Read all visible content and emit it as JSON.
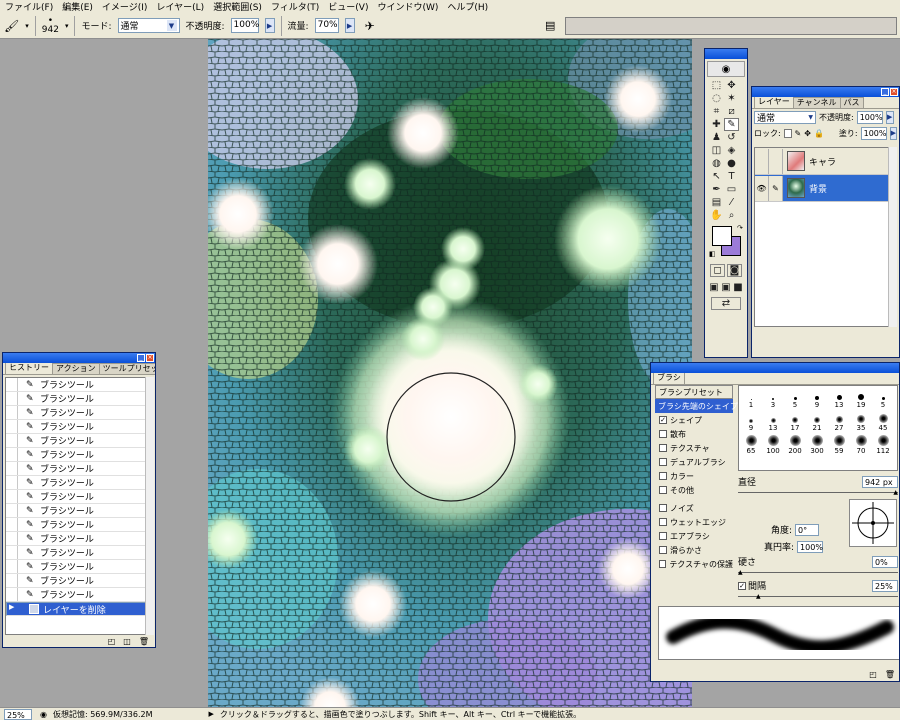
{
  "menubar": {
    "items": [
      "ファイル(F)",
      "編集(E)",
      "イメージ(I)",
      "レイヤー(L)",
      "選択範囲(S)",
      "フィルタ(T)",
      "ビュー(V)",
      "ウインドウ(W)",
      "ヘルプ(H)"
    ]
  },
  "options": {
    "brush_size": "942",
    "mode_label": "モード:",
    "mode_value": "通常",
    "opacity_label": "不透明度:",
    "opacity_value": "100%",
    "flow_label": "流量:",
    "flow_value": "70%"
  },
  "history_panel": {
    "tabs": [
      "ヒストリー",
      "アクション",
      "ツールプリセット"
    ],
    "items": [
      "ブラシツール",
      "ブラシツール",
      "ブラシツール",
      "ブラシツール",
      "ブラシツール",
      "ブラシツール",
      "ブラシツール",
      "ブラシツール",
      "ブラシツール",
      "ブラシツール",
      "ブラシツール",
      "ブラシツール",
      "ブラシツール",
      "ブラシツール",
      "ブラシツール",
      "ブラシツール"
    ],
    "selected": "レイヤーを削除"
  },
  "layers_panel": {
    "tabs": [
      "レイヤー",
      "チャンネル",
      "パス"
    ],
    "blend_mode": "通常",
    "opacity_label": "不透明度:",
    "opacity_value": "100%",
    "lock_label": "ロック:",
    "fill_label": "塗り:",
    "fill_value": "100%",
    "layers": [
      {
        "name": "キャラ",
        "visible": false,
        "active": false
      },
      {
        "name": "背景",
        "visible": true,
        "active": true
      }
    ]
  },
  "brush_panel": {
    "tab": "ブラシ",
    "header": "ブラシプリセット",
    "selected_item": "ブラシ先端のシェイプ",
    "options": [
      {
        "label": "シェイプ",
        "checked": true
      },
      {
        "label": "散布",
        "checked": false
      },
      {
        "label": "テクスチャ",
        "checked": false
      },
      {
        "label": "デュアルブラシ",
        "checked": false
      },
      {
        "label": "カラー",
        "checked": false
      },
      {
        "label": "その他",
        "checked": false
      },
      {
        "label": "ノイズ",
        "checked": false
      },
      {
        "label": "ウェットエッジ",
        "checked": false
      },
      {
        "label": "エアブラシ",
        "checked": false
      },
      {
        "label": "滑らかさ",
        "checked": false
      },
      {
        "label": "テクスチャの保護",
        "checked": false
      }
    ],
    "presets_row1": [
      "1",
      "3",
      "5",
      "9",
      "13",
      "19",
      "5"
    ],
    "presets_row2": [
      "9",
      "13",
      "17",
      "21",
      "27",
      "35",
      "45"
    ],
    "presets_row3": [
      "65",
      "100",
      "200",
      "300",
      "59",
      "70",
      "112"
    ],
    "diameter_label": "直径",
    "diameter_value": "942 px",
    "angle_label": "角度:",
    "angle_value": "0°",
    "roundness_label": "真円率:",
    "roundness_value": "100%",
    "hardness_label": "硬さ",
    "hardness_value": "0%",
    "spacing_label": "間隔",
    "spacing_value": "25%",
    "spacing_checked": true
  },
  "status": {
    "zoom": "25%",
    "memory": "仮想記憶: 569.9M/336.2M",
    "hint": "クリック＆ドラッグすると、描画色で塗りつぶします。Shift キー、Alt キー、Ctrl キーで機能拡張。"
  },
  "colors": {
    "foreground": "#ffffff",
    "background": "#9b7bd8"
  }
}
